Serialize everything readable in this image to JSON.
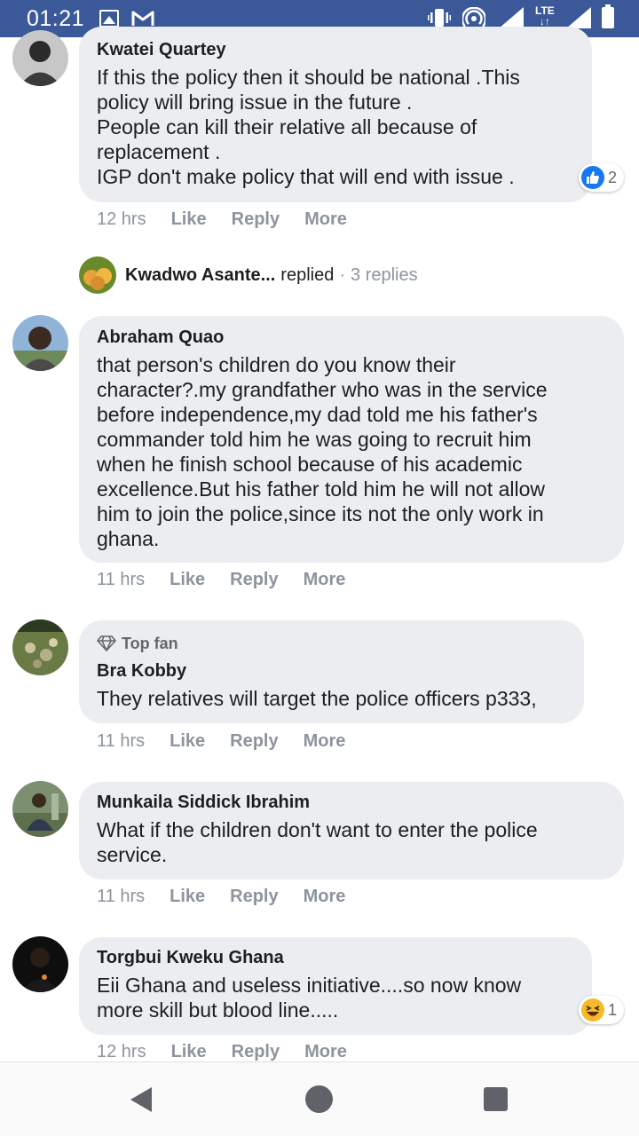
{
  "status_bar": {
    "time": "01:21",
    "icons": [
      "image-icon",
      "gmail-icon",
      "vibrate-icon",
      "hotspot-icon",
      "signal-icon",
      "lte-icon",
      "signal-icon",
      "battery-icon"
    ],
    "lte_label": "LTE",
    "lte_arrows": "↓↑"
  },
  "comments": [
    {
      "author": "Kwatei Quartey",
      "text": "If this the policy then it should be national .This\npolicy will bring issue in the future .\nPeople can kill their relative all because of\nreplacement .\nIGP don't make policy that will end with issue .",
      "time": "12 hrs",
      "reaction": {
        "icon": "like-icon",
        "count": "2"
      }
    },
    {
      "author": "Abraham Quao",
      "text": "that person's children do you know their\ncharacter?.my grandfather who was in the service\nbefore independence,my dad told me his father's\ncommander told him he was going to recruit him\nwhen he finish school because of his academic\nexcellence.But his father told him he will not allow\nhim to join the police,since its not the only work in\nghana.",
      "time": "11 hrs"
    },
    {
      "badge": "Top fan",
      "author": "Bra Kobby",
      "text": "They relatives will target the police officers p333,",
      "time": "11 hrs"
    },
    {
      "author": "Munkaila Siddick Ibrahim",
      "text": "What if the children don't want to enter the police\nservice.",
      "time": "11 hrs"
    },
    {
      "author": "Torgbui Kweku Ghana",
      "text": "Eii Ghana and useless initiative....so now know\nmore skill but blood line.....",
      "time": "12 hrs",
      "reaction": {
        "icon": "haha-icon",
        "count": "1"
      }
    }
  ],
  "actions": {
    "like": "Like",
    "reply": "Reply",
    "more": "More"
  },
  "replies_preview": {
    "name": "Kwadwo Asante...",
    "word": "replied",
    "separator": "·",
    "count": "3 replies"
  },
  "colors": {
    "status_bar": "#3b5998",
    "bubble": "#ebedf0",
    "meta_text": "#8d949e",
    "like_blue": "#1877f2",
    "haha_yellow": "#f7b928"
  }
}
